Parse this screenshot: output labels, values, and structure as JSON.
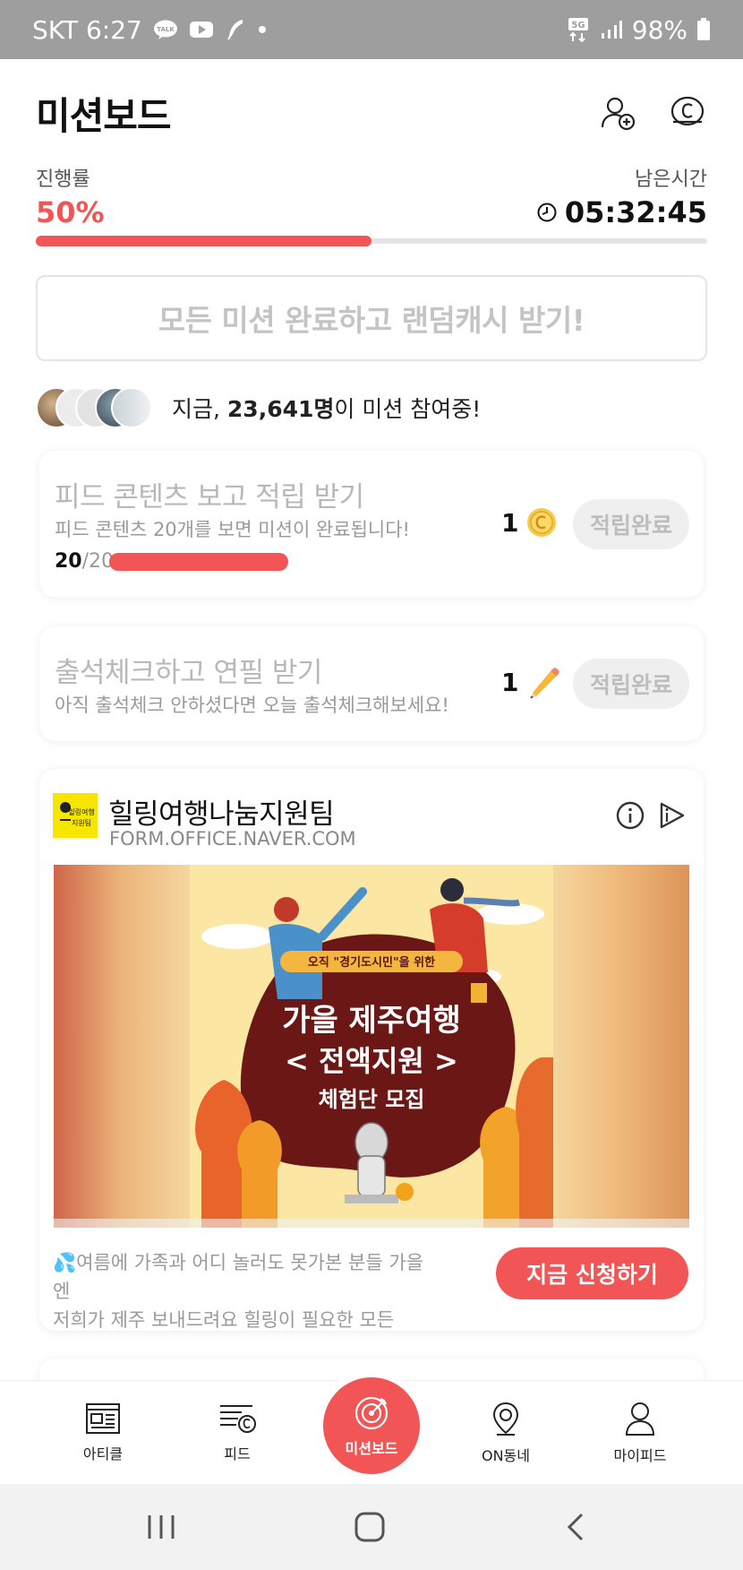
{
  "status_bar": {
    "carrier_time": "SKT 6:27",
    "talk_badge": "TALK",
    "network": "5G",
    "battery": "98%"
  },
  "header": {
    "title": "미션보드",
    "icons": [
      "add-friend-icon",
      "cash-icon"
    ]
  },
  "progress": {
    "label": "진행률",
    "value": "50%",
    "fraction": 0.5,
    "remaining_label": "남은시간",
    "remaining_time": "05:32:45"
  },
  "complete_button": {
    "label": "모든 미션 완료하고 랜덤캐시 받기!"
  },
  "participants": {
    "prefix": "지금, ",
    "count": "23,641명",
    "suffix": "이 미션 참여중!"
  },
  "missions": [
    {
      "title": "피드 콘텐츠 보고 적립 받기",
      "desc": "피드 콘텐츠 20개를 보면 미션이 완료됩니다!",
      "count_done": "20",
      "count_total": "/20",
      "progress": 1.0,
      "reward": "1",
      "reward_icon": "coin-icon",
      "status": "적립완료"
    },
    {
      "title": "출석체크하고 연필 받기",
      "desc": "아직 출석체크 안하셨다면 오늘 출석체크해보세요!",
      "reward": "1",
      "reward_icon": "pencil-icon",
      "status": "적립완료"
    }
  ],
  "ad": {
    "logo_text": "힐링여행\n지원팀",
    "name": "힐링여행나눔지원팀",
    "url": "FORM.OFFICE.NAVER.COM",
    "banner_tag": "오직 \"경기도시민\"을 위한",
    "banner_title_1": "가을 제주여행",
    "banner_title_2": "< 전액지원 >",
    "banner_title_3": "체험단 모집",
    "desc_line1": "💦여름에 가족과 어디 놀러도 못가본 분들 가을엔",
    "desc_line2": "저희가 제주 보내드려요  힐링이 필요한 모든",
    "cta": "지금 신청하기"
  },
  "bottom_nav": {
    "items": [
      "아티클",
      "피드",
      "미션보드",
      "ON동네",
      "마이피드"
    ]
  },
  "colors": {
    "accent": "#f25556",
    "status_bar": "#9e9e9e",
    "muted_text": "#b8b8b8"
  }
}
